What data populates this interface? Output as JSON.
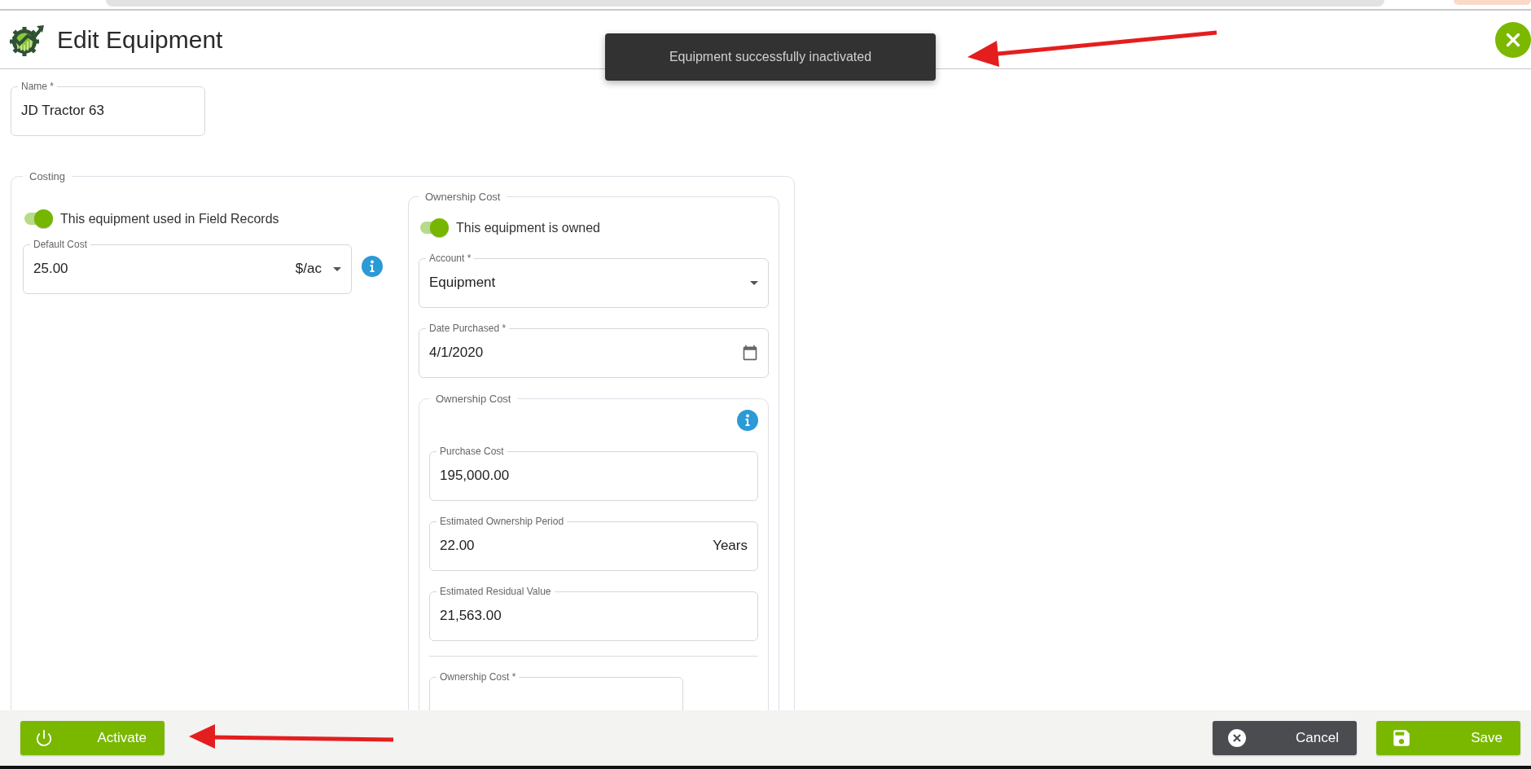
{
  "header": {
    "title": "Edit Equipment"
  },
  "toast": {
    "message": "Equipment successfully inactivated"
  },
  "name_field": {
    "label": "Name *",
    "value": "JD Tractor 63"
  },
  "costing": {
    "legend": "Costing",
    "field_records_toggle": {
      "label": "This equipment used in Field Records",
      "on": true
    },
    "default_cost": {
      "label": "Default Cost",
      "value": "25.00",
      "unit": "$/ac"
    },
    "ownership": {
      "legend": "Ownership Cost",
      "owned_toggle": {
        "label": "This equipment is owned",
        "on": true
      },
      "account": {
        "label": "Account *",
        "value": "Equipment"
      },
      "date_purchased": {
        "label": "Date Purchased *",
        "value": "4/1/2020"
      },
      "cost_section": {
        "legend": "Ownership Cost",
        "fields": [
          {
            "label": "Purchase Cost",
            "value": "195,000.00"
          },
          {
            "label": "Estimated Ownership Period",
            "value": "22.00",
            "unit": "Years"
          },
          {
            "label": "Estimated Residual Value",
            "value": "21,563.00"
          }
        ],
        "ownership_cost_field": {
          "label": "Ownership Cost *"
        }
      }
    }
  },
  "footer": {
    "buttons": [
      {
        "kind": "activate",
        "label": "Activate"
      },
      {
        "kind": "cancel",
        "label": "Cancel"
      },
      {
        "kind": "save",
        "label": "Save"
      }
    ]
  }
}
